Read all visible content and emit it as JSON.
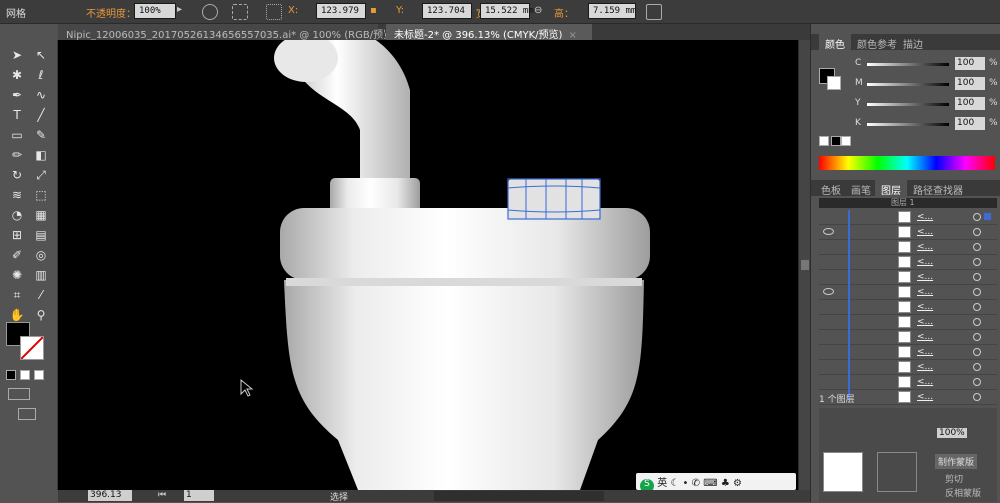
{
  "control_bar": {
    "app_label": "网格",
    "opacity_label": "不透明度：",
    "opacity_value": "100%",
    "x_label": "X:",
    "x_value": "123.979",
    "y_label": "Y:",
    "y_value": "123.704",
    "w_label": "宽：",
    "w_value": "15.522 mm",
    "h_label": "高：",
    "h_value": "7.159 mm"
  },
  "doc_tabs": [
    {
      "label": "Nipic_12006035_20170526134656557035.ai* @ 100% (RGB/预览)",
      "close": "×"
    },
    {
      "label": "未标题-2* @ 396.13% (CMYK/预览)",
      "close": "×"
    }
  ],
  "tools": [
    "select-arrow",
    "direct-select",
    "magic-wand",
    "lasso",
    "pen",
    "curvature",
    "type",
    "line",
    "rectangle",
    "paintbrush",
    "pencil",
    "eraser",
    "rotate",
    "scale",
    "warp",
    "free-transform",
    "shape-builder",
    "perspective",
    "mesh",
    "gradient",
    "eyedropper",
    "blend",
    "symbol-sprayer",
    "column-graph",
    "artboard",
    "slice",
    "hand",
    "zoom"
  ],
  "status": {
    "zoom": "396.13",
    "page": "1",
    "tool_label": "选择"
  },
  "color_panel": {
    "tabs": [
      "颜色",
      "颜色参考",
      "描边"
    ],
    "channels": [
      {
        "label": "C",
        "value": "100",
        "pct": "%"
      },
      {
        "label": "M",
        "value": "100",
        "pct": "%"
      },
      {
        "label": "Y",
        "value": "100",
        "pct": "%"
      },
      {
        "label": "K",
        "value": "100",
        "pct": "%"
      }
    ]
  },
  "layers_panel": {
    "tabs": [
      "色板",
      "画笔",
      "图层",
      "路径查找器"
    ],
    "top_layer_label": "图层 1",
    "item_label": "<...",
    "item_count": 13,
    "visible_rows": [
      1,
      5
    ],
    "footer_label": "1 个图层"
  },
  "transparency": {
    "opacity_value": "100%",
    "button_label": "制作蒙版",
    "clip_label": "剪切",
    "invert_label": "反相蒙版"
  },
  "ime": {
    "lang": "英",
    "logo": "S"
  },
  "colors": {
    "accent": "#e69a38",
    "selection": "#3b6bd6",
    "canvas": "#000000",
    "panel": "#535353"
  }
}
